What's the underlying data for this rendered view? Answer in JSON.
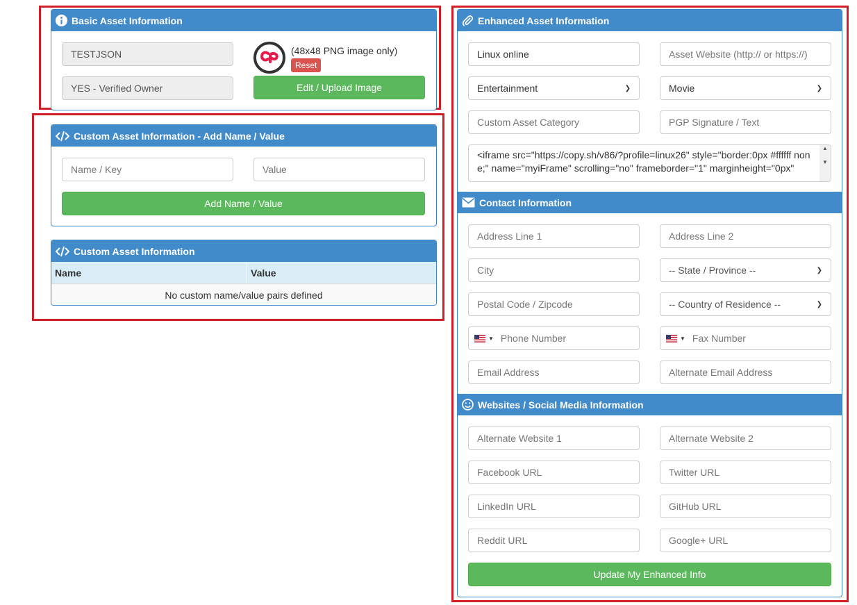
{
  "basic": {
    "title": "Basic Asset Information",
    "asset_name": "TESTJSON",
    "ownership": "YES - Verified Owner",
    "image_note": "(48x48 PNG image only)",
    "reset_label": "Reset",
    "upload_label": "Edit / Upload Image"
  },
  "custom_add": {
    "title": "Custom Asset Information - Add Name / Value",
    "name_placeholder": "Name / Key",
    "value_placeholder": "Value",
    "add_label": "Add Name / Value"
  },
  "custom_table": {
    "title": "Custom Asset Information",
    "columns": [
      "Name",
      "Value"
    ],
    "empty_text": "No custom name/value pairs defined"
  },
  "enhanced": {
    "title": "Enhanced Asset Information",
    "asset_title_value": "Linux online",
    "website_placeholder": "Asset Website (http:// or https://)",
    "category_selected": "Entertainment",
    "subcategory_selected": "Movie",
    "custom_category_placeholder": "Custom Asset Category",
    "pgp_placeholder": "PGP Signature / Text",
    "description_value": "<iframe src=\"https://copy.sh/v86/?profile=linux26\" style=\"border:0px #ffffff none;\" name=\"myiFrame\" scrolling=\"no\" frameborder=\"1\" marginheight=\"0px\""
  },
  "contact": {
    "title": "Contact Information",
    "address1": "Address Line 1",
    "address2": "Address Line 2",
    "city": "City",
    "state": "-- State / Province --",
    "postal": "Postal Code / Zipcode",
    "country": "-- Country of Residence --",
    "phone": "Phone Number",
    "fax": "Fax Number",
    "email": "Email Address",
    "alt_email": "Alternate Email Address"
  },
  "social": {
    "title": "Websites / Social Media Information",
    "alt_website1": "Alternate Website 1",
    "alt_website2": "Alternate Website 2",
    "facebook": "Facebook URL",
    "twitter": "Twitter URL",
    "linkedin": "LinkedIn URL",
    "github": "GitHub URL",
    "reddit": "Reddit URL",
    "googleplus": "Google+ URL"
  },
  "update_label": "Update My Enhanced Info",
  "colors": {
    "header_blue": "#428bca",
    "success_green": "#5cb85c",
    "danger_red": "#d9534f",
    "highlight_red": "#d01f26",
    "table_header": "#d9edf7"
  },
  "icons": {
    "basic": "info-circle-icon",
    "custom": "code-icon",
    "enhanced": "paperclip-icon",
    "contact": "envelope-icon",
    "social": "smiley-icon"
  }
}
